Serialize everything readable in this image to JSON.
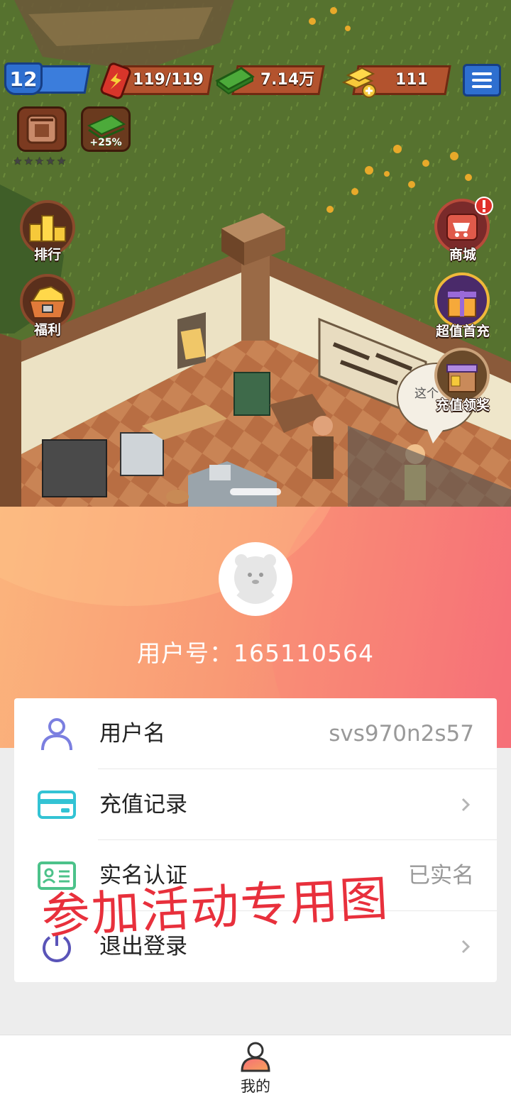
{
  "hud": {
    "level": "12",
    "energy": "119/119",
    "cash": "7.14万",
    "gold": "111",
    "bonus_badge": "+25%",
    "stars_filled": 0,
    "stars_total": 5
  },
  "side_buttons": {
    "rank_label": "排行",
    "welfare_label": "福利",
    "shop_label": "商城",
    "first_charge_label": "超值首充",
    "recharge_reward_label": "充值领奖",
    "speech_bubble_text": "这个"
  },
  "profile": {
    "user_id_text": "用户号：165110564"
  },
  "menu": {
    "username_label": "用户名",
    "username_value": "svs970n2s57",
    "recharge_label": "充值记录",
    "realname_label": "实名认证",
    "realname_value": "已实名",
    "logout_label": "退出登录"
  },
  "watermark": "参加活动专用图",
  "tabbar": {
    "mine_label": "我的"
  },
  "colors": {
    "accent_icon": "#7b7fe0",
    "card_icon": "#33c3d4",
    "id_icon": "#4cc28a",
    "watermark": "#e8303c"
  }
}
